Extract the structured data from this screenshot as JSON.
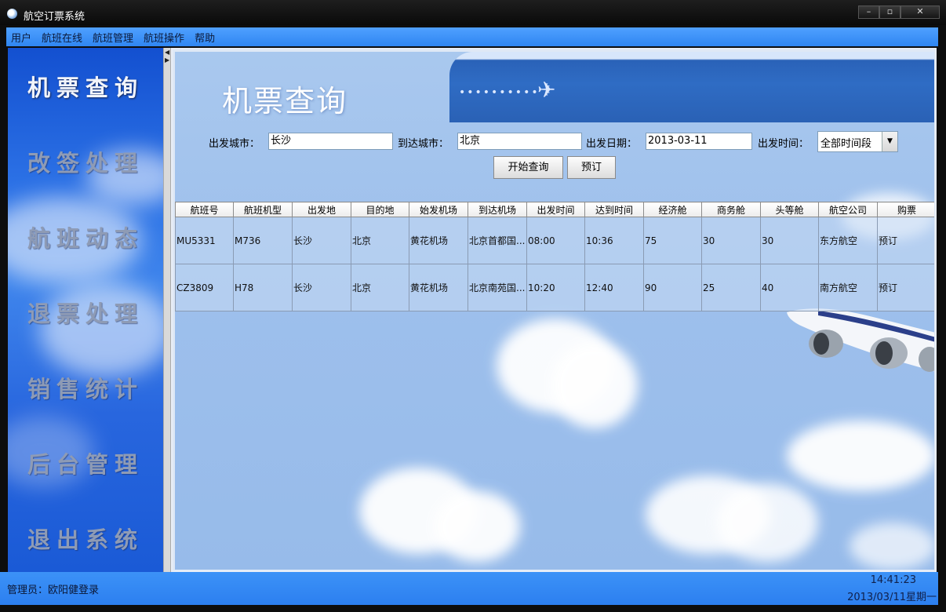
{
  "window": {
    "title": "航空订票系统",
    "buttons": [
      "–",
      "▫",
      "✕"
    ]
  },
  "menu": [
    "用户",
    "航班在线",
    "航班管理",
    "航班操作",
    "帮助"
  ],
  "sidebar": {
    "items": [
      {
        "label": "机票查询",
        "active": true
      },
      {
        "label": "改签处理",
        "active": false
      },
      {
        "label": "航班动态",
        "active": false
      },
      {
        "label": "退票处理",
        "active": false
      },
      {
        "label": "销售统计",
        "active": false
      },
      {
        "label": "后台管理",
        "active": false
      },
      {
        "label": "退出系统",
        "active": false
      }
    ]
  },
  "page": {
    "title": "机票查询"
  },
  "search": {
    "from_label": "出发城市：",
    "from_value": "长沙",
    "to_label": "到达城市：",
    "to_value": "北京",
    "date_label": "出发日期：",
    "date_value": "2013-03-11",
    "time_label": "出发时间：",
    "time_value": "全部时间段",
    "search_button": "开始查询",
    "book_button": "预订"
  },
  "table": {
    "headers": [
      "航班号",
      "航班机型",
      "出发地",
      "目的地",
      "始发机场",
      "到达机场",
      "出发时间",
      "达到时间",
      "经济舱",
      "商务舱",
      "头等舱",
      "航空公司",
      "购票"
    ],
    "rows": [
      [
        "MU5331",
        "M736",
        "长沙",
        "北京",
        "黄花机场",
        "北京首都国...",
        "08:00",
        "10:36",
        "75",
        "30",
        "30",
        "东方航空",
        "预订"
      ],
      [
        "CZ3809",
        "H78",
        "长沙",
        "北京",
        "黄花机场",
        "北京南苑国...",
        "10:20",
        "12:40",
        "90",
        "25",
        "40",
        "南方航空",
        "预订"
      ]
    ]
  },
  "status": {
    "user": "管理员：欧阳健登录",
    "time": "14:41:23",
    "date": "2013/03/11星期一"
  },
  "colors": {
    "accent": "#2f86f2",
    "sidebar": "#2b70e5",
    "sky": "#a9c8ee"
  }
}
